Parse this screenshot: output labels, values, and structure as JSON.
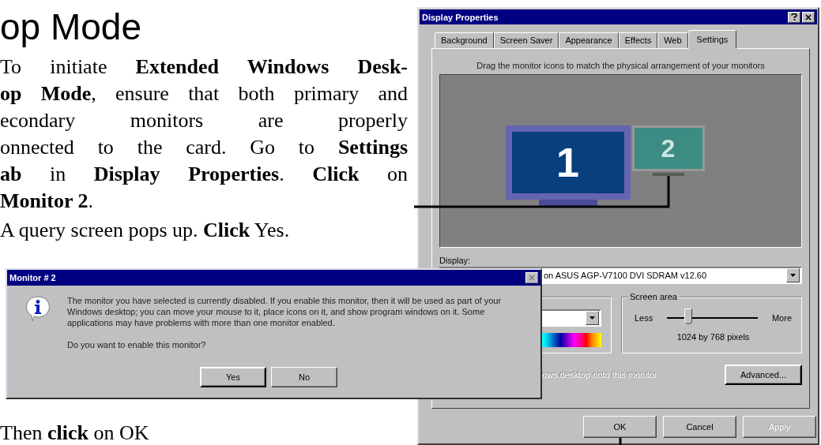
{
  "page": {
    "heading": "op Mode",
    "paragraph_lines": [
      "To initiate **Extended Windows Desk-**",
      "**op Mode**, ensure that both primary and",
      "econdary monitors are properly",
      "onnected to the card. Go to **Settings**",
      "**ab** in **Display Properties**. **Click** on",
      "**Monitor 2**."
    ],
    "step_2": "A query screen pops up. **Click** Yes.",
    "step_3": "Then **click** on OK"
  },
  "display_properties": {
    "title": "Display Properties",
    "tabs": [
      {
        "label": "Background",
        "selected": false
      },
      {
        "label": "Screen Saver",
        "selected": false
      },
      {
        "label": "Appearance",
        "selected": false
      },
      {
        "label": "Effects",
        "selected": false
      },
      {
        "label": "Web",
        "selected": false
      },
      {
        "label": "Settings",
        "selected": true
      }
    ],
    "instruction": "Drag the monitor icons to match the physical arrangement of your monitors",
    "monitors": [
      {
        "label": "1",
        "kind": "primary",
        "selected": true
      },
      {
        "label": "2",
        "kind": "secondary",
        "selected": false
      }
    ],
    "display_label": "Display:",
    "display_value": "on ASUS AGP-V7100 DVI SDRAM v12.60",
    "screen_area": {
      "title": "Screen area",
      "min_label": "Less",
      "max_label": "More",
      "level": 0.23,
      "reading": "1024 by 768 pixels"
    },
    "extend_option": {
      "label": "ows desktop onto this monitor.",
      "disabled": true
    },
    "advanced_button": "Advanced...",
    "buttons": [
      {
        "label": "OK",
        "disabled": false
      },
      {
        "label": "Cancel",
        "disabled": false
      },
      {
        "label": "Apply",
        "disabled": true
      }
    ]
  },
  "monitor_dialog": {
    "title": "Monitor # 2",
    "message": "The monitor you have selected is currently disabled. If you enable this monitor, then it will be used as part of your Windows desktop; you can move your mouse to it, place icons on it, and show program windows on it. Some applications may have problems with more than one monitor enabled.",
    "question": "Do you want to enable this monitor?",
    "buttons": [
      {
        "label": "Yes",
        "default": true
      },
      {
        "label": "No",
        "default": false
      }
    ]
  }
}
